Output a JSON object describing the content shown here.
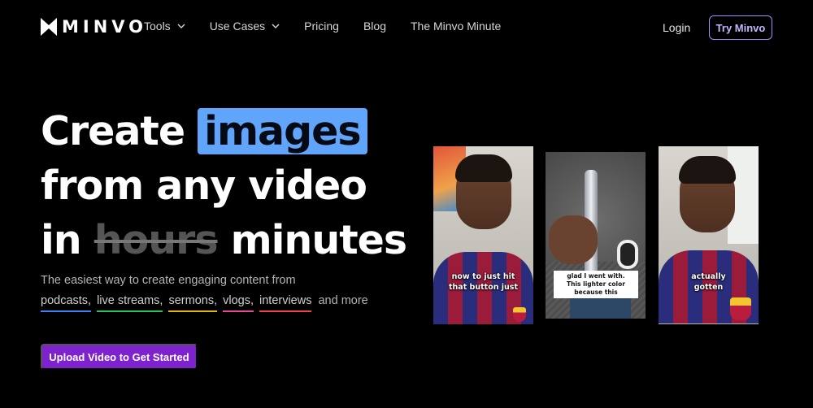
{
  "brand": {
    "name": "MINVO"
  },
  "nav": {
    "links": [
      {
        "label": "Tools",
        "dropdown": true
      },
      {
        "label": "Use Cases",
        "dropdown": true
      },
      {
        "label": "Pricing",
        "dropdown": false
      },
      {
        "label": "Blog",
        "dropdown": false
      },
      {
        "label": "The Minvo Minute",
        "dropdown": false
      }
    ],
    "login": "Login",
    "try": "Try Minvo"
  },
  "hero": {
    "line1_prefix": "Create",
    "line1_highlight": "images",
    "line2": "from any video",
    "line3_prefix": "in",
    "line3_strike": "hours",
    "line3_suffix": "minutes",
    "subtitle": "The easiest way to create engaging content from",
    "tags": [
      {
        "label": "podcasts,",
        "color": "#3b82f6"
      },
      {
        "label": "live streams,",
        "color": "#22c55e"
      },
      {
        "label": "sermons,",
        "color": "#eab308"
      },
      {
        "label": "vlogs,",
        "color": "#ec4899"
      },
      {
        "label": "interviews",
        "color": "#ef4444"
      }
    ],
    "tags_suffix": "and more",
    "cta": "Upload Video to Get Started"
  },
  "videos": {
    "card1_caption_line1": "now to just hit",
    "card1_caption_line2": "that button just",
    "card2_caption_line1": "glad I went with.",
    "card2_caption_line2": "This lighter color because this",
    "card3_caption_line1": "actually",
    "card3_caption_line2": "gotten"
  },
  "colors": {
    "highlight": "#60a5fa",
    "cta": "#7e22ce",
    "try_border": "#a78bfa"
  }
}
